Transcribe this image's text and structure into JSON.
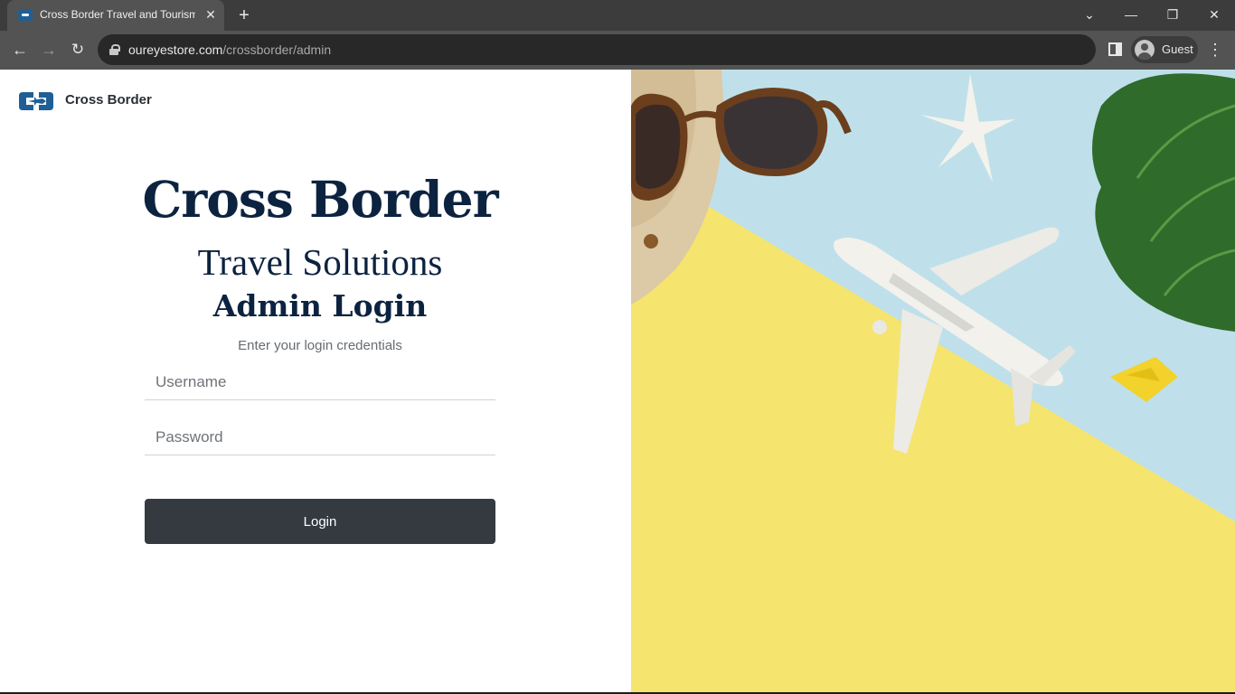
{
  "browser": {
    "tab_title": "Cross Border Travel and Tourism",
    "tab_close": "✕",
    "new_tab": "+",
    "url_domain": "oureyestore.com",
    "url_path": "/crossborder/admin",
    "profile_label": "Guest",
    "icons": {
      "back": "←",
      "forward": "→",
      "reload": "↻",
      "tab_search": "⌄",
      "minimize": "—",
      "restore": "❐",
      "close": "✕",
      "menu": "⋮"
    }
  },
  "page": {
    "brand_name": "Cross Border",
    "title": "Cross Border",
    "subtitle": "Travel Solutions",
    "heading": "Admin Login",
    "hint": "Enter your login credentials",
    "username_placeholder": "Username",
    "username_value": "",
    "password_placeholder": "Password",
    "password_value": "",
    "login_label": "Login",
    "image_subject": "travel flat-lay: sunglasses, straw hat, starfish, toy airplane, monstera leaf, paper boat",
    "colors": {
      "heading": "#0c2340",
      "button": "#343a40",
      "brand_logo": "#1f5f96",
      "bg_yellow": "#f5e46e",
      "bg_blue": "#bfe0ea"
    }
  }
}
